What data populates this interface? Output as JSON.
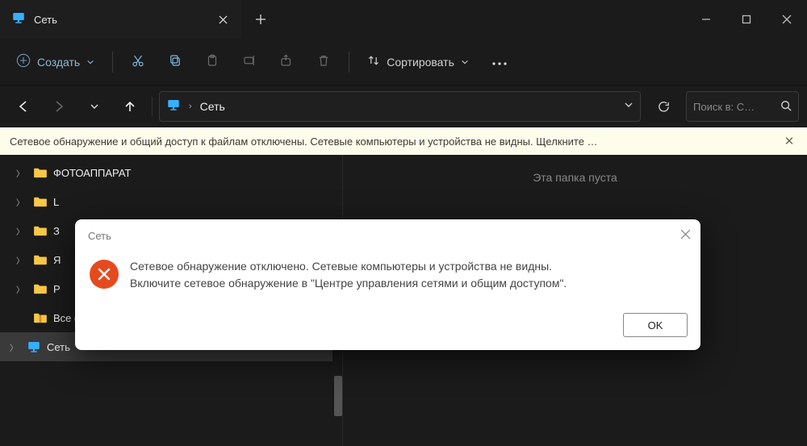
{
  "titlebar": {
    "tab_title": "Сеть"
  },
  "toolbar": {
    "new_label": "Создать",
    "sort_label": "Сортировать"
  },
  "addressbar": {
    "path_segment": "Сеть",
    "search_placeholder": "Поиск в: С…"
  },
  "infobar": {
    "text": "Сетевое обнаружение и общий доступ к файлам отключены. Сетевые компьютеры и устройства не видны. Щелкните …"
  },
  "tree": {
    "items": [
      {
        "label": "ФОТОАППАРАТ"
      },
      {
        "label": "L"
      },
      {
        "label": "З"
      },
      {
        "label": "Я"
      },
      {
        "label": "Р"
      },
      {
        "label": "Все файлы с облака МАЙЛ РУ.zip"
      },
      {
        "label": "Сеть"
      }
    ]
  },
  "main": {
    "empty_text": "Эта папка пуста"
  },
  "dialog": {
    "title": "Сеть",
    "line1": "Сетевое обнаружение отключено. Сетевые компьютеры и устройства не видны.",
    "line2": "Включите сетевое обнаружение в \"Центре управления сетями и общим доступом\".",
    "ok": "OK"
  }
}
